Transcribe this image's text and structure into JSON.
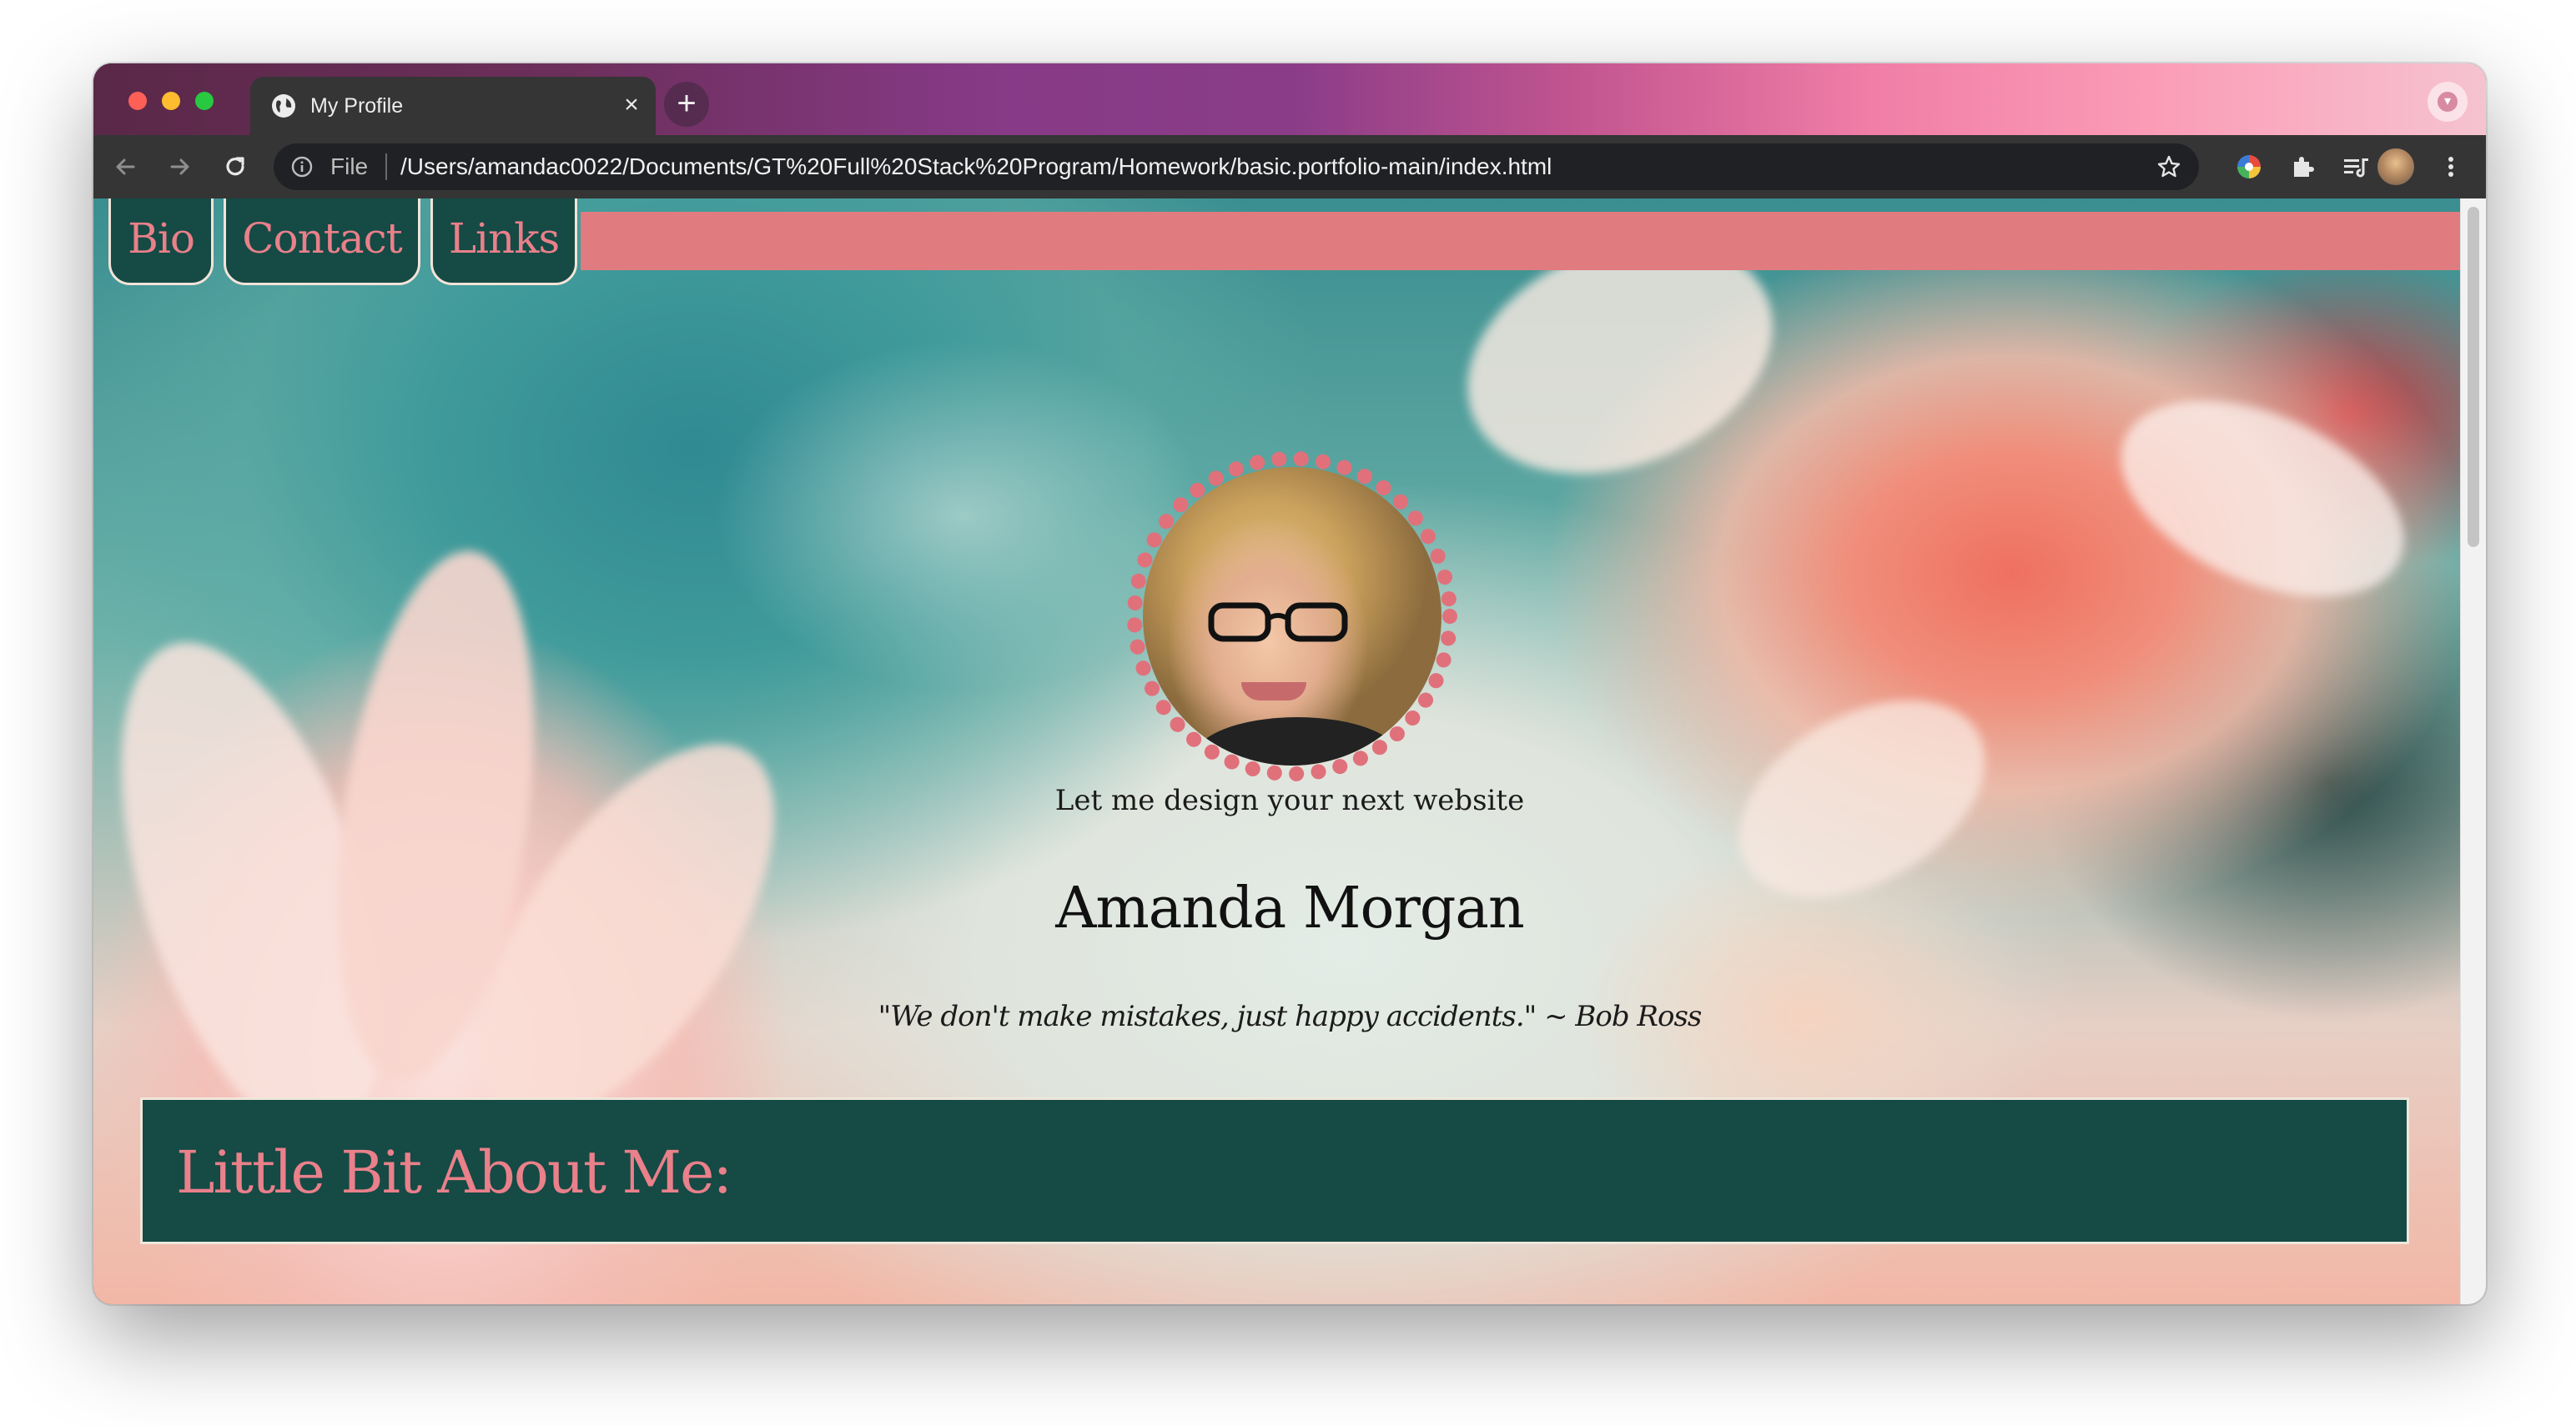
{
  "browser": {
    "tab": {
      "title": "My Profile",
      "close": "×"
    },
    "new_tab": "+",
    "omnibox": {
      "scheme_label": "File",
      "url": "/Users/amandac0022/Documents/GT%20Full%20Stack%20Program/Homework/basic.portfolio-main/index.html"
    }
  },
  "page": {
    "nav": {
      "bio": "Bio",
      "contact": "Contact",
      "links": "Links"
    },
    "tagline": "Let me design your next website",
    "name": "Amanda Morgan",
    "quote": "\"We don't make mistakes, just happy accidents.\" ~ Bob Ross",
    "about_heading": "Little Bit About Me:"
  },
  "colors": {
    "accent_pink": "#e07b80",
    "dark_green": "#154a45",
    "heading_pink": "#e9808a"
  }
}
